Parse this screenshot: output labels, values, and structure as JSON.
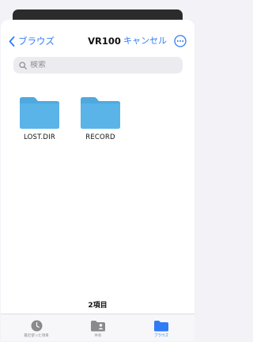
{
  "nav": {
    "back_label": "ブラウズ",
    "title": "VR100",
    "cancel_label": "キャンセル"
  },
  "search": {
    "placeholder": "検索"
  },
  "folders": [
    {
      "name": "LOST.DIR"
    },
    {
      "name": "RECORD"
    }
  ],
  "item_count": "2項目",
  "tabs": [
    {
      "label": "最近使った項目",
      "icon": "clock-icon",
      "active": false
    },
    {
      "label": "共有",
      "icon": "shared-folder-icon",
      "active": false
    },
    {
      "label": "ブラウズ",
      "icon": "folder-icon",
      "active": true
    }
  ],
  "colors": {
    "accent": "#2f7cf6",
    "folder": "#5ab4e8"
  }
}
